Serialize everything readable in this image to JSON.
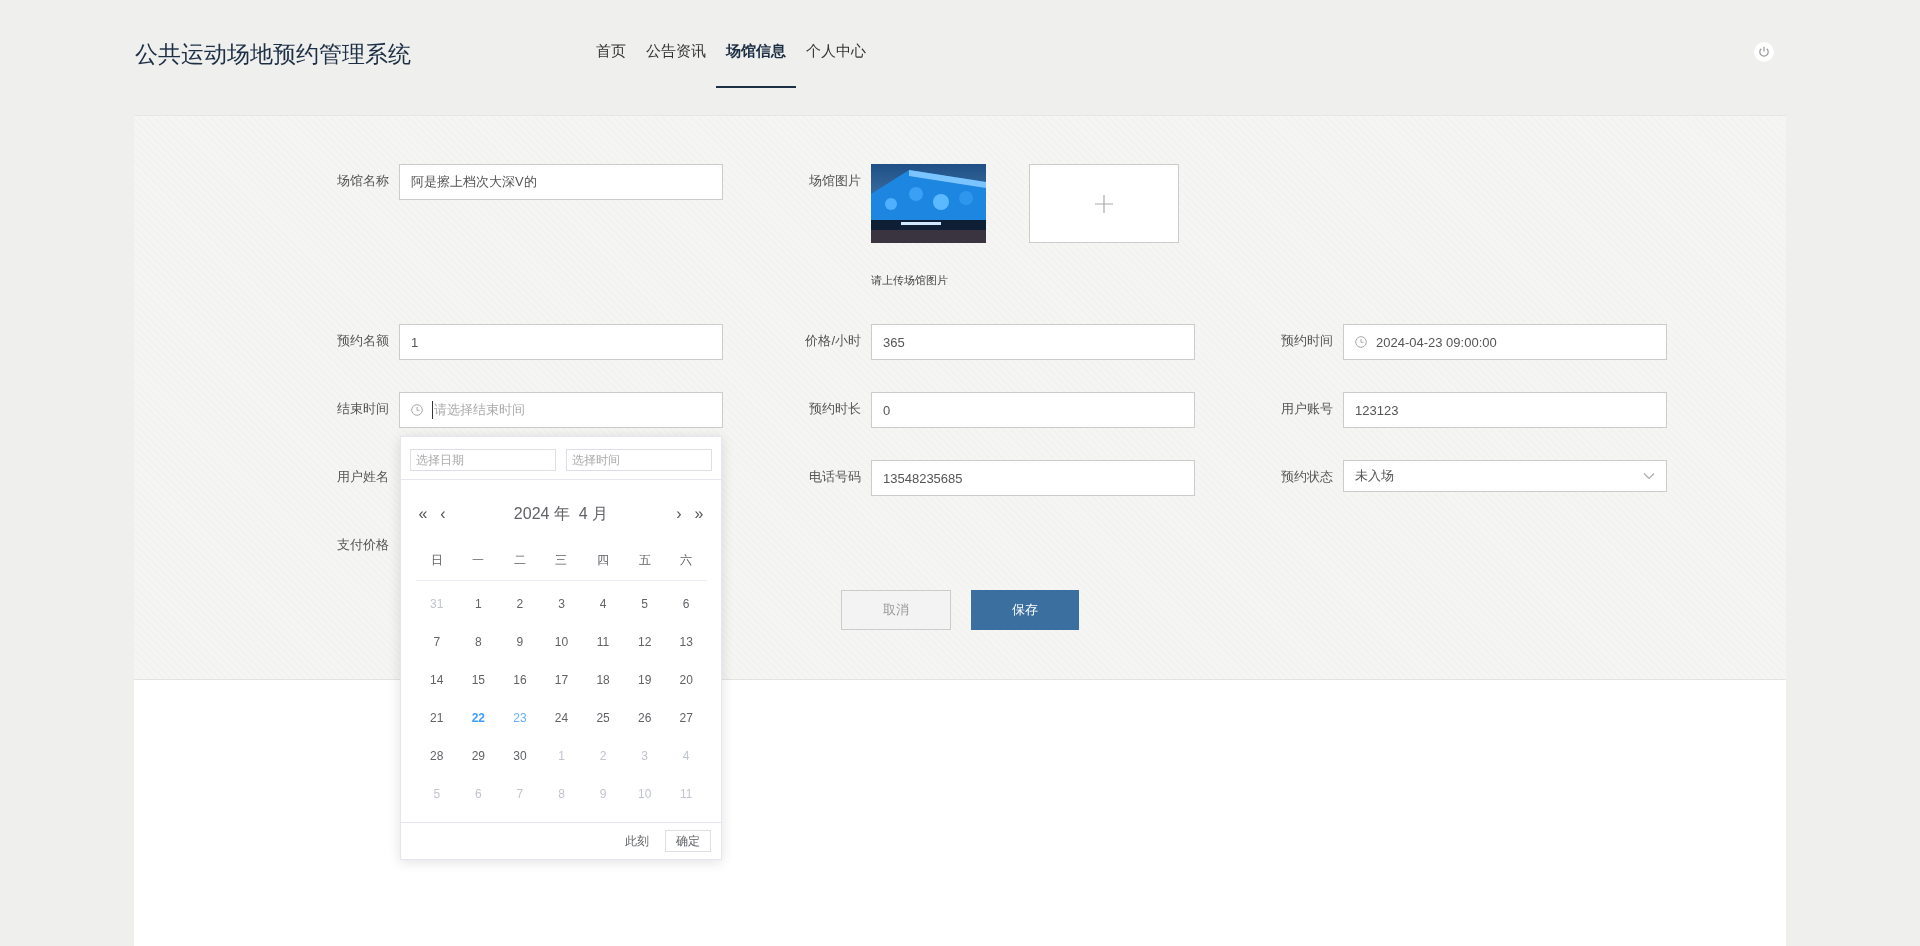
{
  "header": {
    "title": "公共运动场地预约管理系统",
    "nav": [
      {
        "label": "首页",
        "selected": false
      },
      {
        "label": "公告资讯",
        "selected": false
      },
      {
        "label": "场馆信息",
        "selected": true
      },
      {
        "label": "个人中心",
        "selected": false
      }
    ]
  },
  "form": {
    "rows": [
      [
        {
          "kind": "text",
          "label": "场馆名称",
          "value": "阿是擦上档次大深V的"
        },
        {
          "label": "场馆图片",
          "caption": "请上传场馆图片"
        }
      ],
      [
        {
          "kind": "text",
          "label": "预约名额",
          "value": "1"
        },
        {
          "kind": "text",
          "label": "价格/小时",
          "value": "365"
        },
        {
          "kind": "datetime",
          "label": "预约时间",
          "value": "2024-04-23 09:00:00"
        }
      ],
      [
        {
          "kind": "datetime_picker",
          "label": "结束时间",
          "placeholder": "请选择结束时间"
        },
        {
          "kind": "text",
          "label": "预约时长",
          "value": "0"
        },
        {
          "kind": "text",
          "label": "用户账号",
          "value": "123123"
        }
      ],
      [
        {
          "kind": "covered",
          "label": "用户姓名"
        },
        {
          "kind": "text",
          "label": "电话号码",
          "value": "13548235685"
        },
        {
          "kind": "select",
          "label": "预约状态",
          "value": "未入场"
        }
      ],
      [
        {
          "kind": "covered",
          "label": "支付价格"
        }
      ]
    ],
    "buttons": [
      {
        "kind": "cancel",
        "label": "取消"
      },
      {
        "kind": "primary",
        "label": "保存"
      }
    ]
  },
  "date_picker": {
    "date_placeholder": "选择日期",
    "time_placeholder": "选择时间",
    "prev_year": "«",
    "prev_month": "‹",
    "month_title": "2024 年  4 月",
    "next_month": "›",
    "next_year": "»",
    "weekdays": [
      "日",
      "一",
      "二",
      "三",
      "四",
      "五",
      "六"
    ],
    "days": [
      {
        "label": "31",
        "kind": "other"
      },
      {
        "label": "1",
        "kind": "normal"
      },
      {
        "label": "2",
        "kind": "normal"
      },
      {
        "label": "3",
        "kind": "normal"
      },
      {
        "label": "4",
        "kind": "normal"
      },
      {
        "label": "5",
        "kind": "normal"
      },
      {
        "label": "6",
        "kind": "normal"
      },
      {
        "label": "7",
        "kind": "normal"
      },
      {
        "label": "8",
        "kind": "normal"
      },
      {
        "label": "9",
        "kind": "normal"
      },
      {
        "label": "10",
        "kind": "normal"
      },
      {
        "label": "11",
        "kind": "normal"
      },
      {
        "label": "12",
        "kind": "normal"
      },
      {
        "label": "13",
        "kind": "normal"
      },
      {
        "label": "14",
        "kind": "normal"
      },
      {
        "label": "15",
        "kind": "normal"
      },
      {
        "label": "16",
        "kind": "normal"
      },
      {
        "label": "17",
        "kind": "normal"
      },
      {
        "label": "18",
        "kind": "normal"
      },
      {
        "label": "19",
        "kind": "normal"
      },
      {
        "label": "20",
        "kind": "normal"
      },
      {
        "label": "21",
        "kind": "normal"
      },
      {
        "label": "22",
        "kind": "today"
      },
      {
        "label": "23",
        "kind": "hover"
      },
      {
        "label": "24",
        "kind": "normal"
      },
      {
        "label": "25",
        "kind": "normal"
      },
      {
        "label": "26",
        "kind": "normal"
      },
      {
        "label": "27",
        "kind": "normal"
      },
      {
        "label": "28",
        "kind": "normal"
      },
      {
        "label": "29",
        "kind": "normal"
      },
      {
        "label": "30",
        "kind": "normal"
      },
      {
        "label": "1",
        "kind": "other"
      },
      {
        "label": "2",
        "kind": "other"
      },
      {
        "label": "3",
        "kind": "other"
      },
      {
        "label": "4",
        "kind": "other"
      },
      {
        "label": "5",
        "kind": "other"
      },
      {
        "label": "6",
        "kind": "other"
      },
      {
        "label": "7",
        "kind": "other"
      },
      {
        "label": "8",
        "kind": "other"
      },
      {
        "label": "9",
        "kind": "other"
      },
      {
        "label": "10",
        "kind": "other"
      },
      {
        "label": "11",
        "kind": "other"
      }
    ],
    "now_label": "此刻",
    "confirm_label": "确定"
  }
}
